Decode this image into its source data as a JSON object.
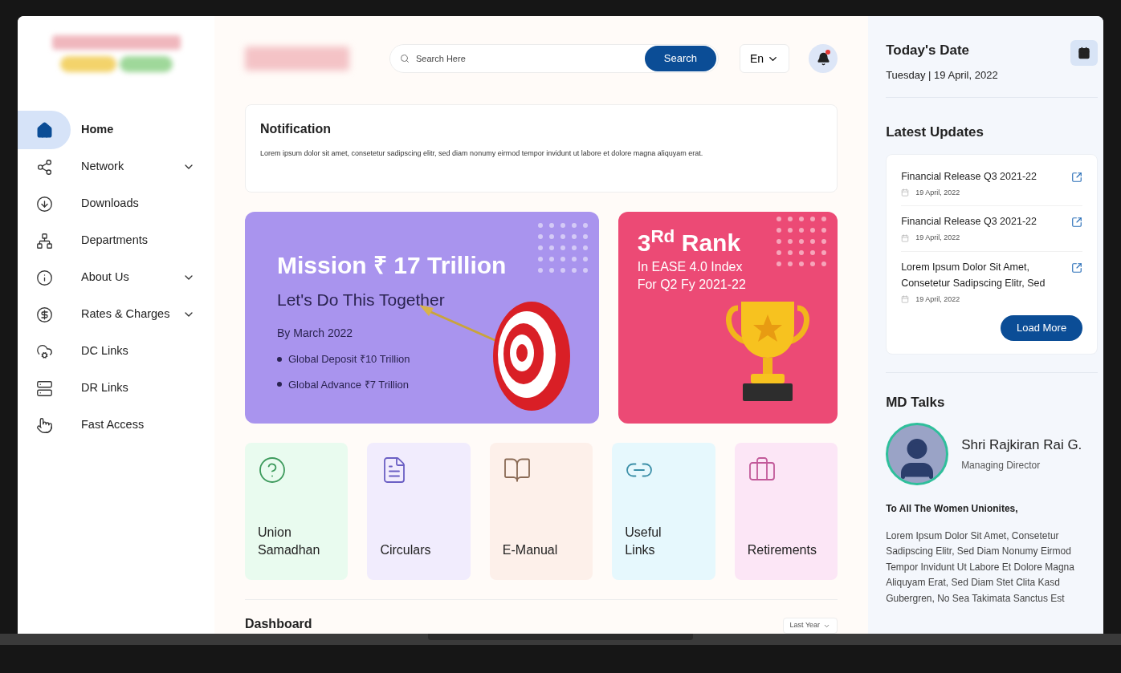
{
  "sidebar": {
    "items": [
      {
        "label": "Home",
        "selected": true,
        "has_submenu": false
      },
      {
        "label": "Network",
        "selected": false,
        "has_submenu": true
      },
      {
        "label": "Downloads",
        "selected": false,
        "has_submenu": false
      },
      {
        "label": "Departments",
        "selected": false,
        "has_submenu": false
      },
      {
        "label": "About Us",
        "selected": false,
        "has_submenu": true
      },
      {
        "label": "Rates & Charges",
        "selected": false,
        "has_submenu": true
      },
      {
        "label": "DC Links",
        "selected": false,
        "has_submenu": false
      },
      {
        "label": "DR Links",
        "selected": false,
        "has_submenu": false
      },
      {
        "label": "Fast Access",
        "selected": false,
        "has_submenu": false
      }
    ]
  },
  "header": {
    "search": {
      "placeholder": "Search Here",
      "button": "Search"
    },
    "language": "En"
  },
  "notification": {
    "title": "Notification",
    "text": "Lorem ipsum dolor sit amet, consetetur sadipscing elitr, sed diam nonumy eirmod tempor invidunt ut labore et dolore magna aliquyam erat."
  },
  "banners": [
    {
      "kind": "target",
      "title": "Mission ₹ 17 Trillion",
      "subtitle": "Let's Do This Together",
      "note": "By March 2022",
      "bullets": [
        "Global Deposit ₹10 Trillion",
        "Global Advance ₹7 Trillion"
      ]
    },
    {
      "kind": "trophy",
      "title": "3$^{Rd}$ Rank",
      "lines": [
        "In EASE 4.0 Index",
        "For Q2 Fy 2021-22"
      ]
    }
  ],
  "tiles": [
    {
      "label": "Union\nSamadhan",
      "color": "#e9fbef"
    },
    {
      "label": "Circulars",
      "color": "#f1ecfd"
    },
    {
      "label": "E-Manual",
      "color": "#fdf0ea"
    },
    {
      "label": "Useful\nLinks",
      "color": "#e6f8fd"
    },
    {
      "label": "Retirements",
      "color": "#fce6f6"
    }
  ],
  "dashboard": {
    "title": "Dashboard",
    "filter": "Last Year"
  },
  "right_panel": {
    "date_title": "Today's Date",
    "date": "Tuesday | 19 April, 2022",
    "updates_title": "Latest Updates",
    "updates": [
      {
        "title": "Financial Release Q3 2021-22",
        "date": "19 April, 2022"
      },
      {
        "title": "Financial Release Q3 2021-22",
        "date": "19 April, 2022"
      },
      {
        "title": "Lorem Ipsum Dolor Sit Amet, Consetetur Sadipscing Elitr, Sed",
        "date": "19 April, 2022"
      }
    ],
    "load_more": "Load More",
    "md_title": "MD Talks",
    "md_name": "Shri Rajkiran Rai G.",
    "md_role": "Managing Director",
    "greeting": "To All The Women Unionites,",
    "message": "Lorem Ipsum Dolor Sit Amet, Consetetur Sadipscing Elitr, Sed Diam Nonumy Eirmod Tempor Invidunt Ut Labore Et Dolore Magna Aliquyam Erat, Sed Diam Stet Clita Kasd Gubergren, No Sea Takimata Sanctus Est"
  }
}
